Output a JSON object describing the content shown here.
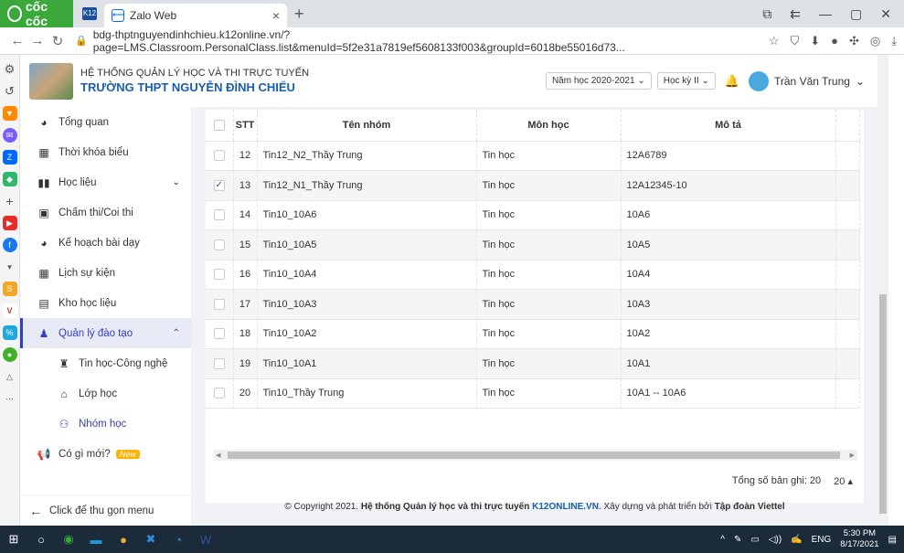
{
  "browser": {
    "brand": "cốc cốc",
    "tab_icon_text": "K12",
    "tab_label": "Zalo Web",
    "tab_close": "×",
    "new_tab": "+",
    "url": "bdg-thptnguyendinhchieu.k12online.vn/?page=LMS.Classroom.PersonalClass.list&menuId=5f2e31a7819ef5608133f003&groupId=6018be55016d73..."
  },
  "header": {
    "system_title": "HỆ THỐNG QUẢN LÝ HỌC VÀ THI TRỰC TUYẾN",
    "school_name": "TRƯỜNG THPT NGUYỄN ĐÌNH CHIỂU",
    "school_year": "Năm học 2020-2021",
    "semester": "Học kỳ II",
    "user_name": "Trần Văn Trung"
  },
  "menu": {
    "items": [
      {
        "label": "Tổng quan"
      },
      {
        "label": "Thời khóa biểu"
      },
      {
        "label": "Học liệu"
      },
      {
        "label": "Chấm thi/Coi thi"
      },
      {
        "label": "Kế hoạch bài dạy"
      },
      {
        "label": "Lịch sự kiện"
      },
      {
        "label": "Kho học liệu"
      },
      {
        "label": "Quản lý đào tạo"
      },
      {
        "label": "Tin học-Công nghệ"
      },
      {
        "label": "Lớp học"
      },
      {
        "label": "Nhóm học"
      },
      {
        "label": "Có gì mới?"
      }
    ],
    "new_badge": "New",
    "collapse_label": "Click để thu gọn menu"
  },
  "table": {
    "headers": [
      "STT",
      "Tên nhóm",
      "Môn học",
      "Mô tả"
    ],
    "rows": [
      {
        "stt": "12",
        "name": "Tin12_N2_Thầy Trung",
        "subject": "Tin học",
        "desc": "12A6789",
        "checked": false
      },
      {
        "stt": "13",
        "name": "Tin12_N1_Thầy Trung",
        "subject": "Tin học",
        "desc": "12A12345-10",
        "checked": true
      },
      {
        "stt": "14",
        "name": "Tin10_10A6",
        "subject": "Tin học",
        "desc": "10A6",
        "checked": false
      },
      {
        "stt": "15",
        "name": "Tin10_10A5",
        "subject": "Tin học",
        "desc": "10A5",
        "checked": false
      },
      {
        "stt": "16",
        "name": "Tin10_10A4",
        "subject": "Tin học",
        "desc": "10A4",
        "checked": false
      },
      {
        "stt": "17",
        "name": "Tin10_10A3",
        "subject": "Tin học",
        "desc": "10A3",
        "checked": false
      },
      {
        "stt": "18",
        "name": "Tin10_10A2",
        "subject": "Tin học",
        "desc": "10A2",
        "checked": false
      },
      {
        "stt": "19",
        "name": "Tin10_10A1",
        "subject": "Tin học",
        "desc": "10A1",
        "checked": false
      },
      {
        "stt": "20",
        "name": "Tin10_Thầy Trung",
        "subject": "Tin học",
        "desc": "10A1 -- 10A6",
        "checked": false
      }
    ],
    "total_label": "Tổng số bản ghi: 20",
    "page_size": "20 ▴"
  },
  "footer": {
    "prefix": "© Copyright 2021.",
    "system": "Hệ thống Quản lý học và thi trực tuyến",
    "site": "K12ONLINE.VN",
    "middle": ". Xây dựng và phát triển bởi",
    "company": "Tập đoàn Viettel"
  },
  "taskbar": {
    "lang": "ENG",
    "time": "5:30 PM",
    "date": "8/17/2021"
  },
  "colors": {
    "accent": "#3340c0",
    "brand_green": "#3aa83a",
    "link_blue": "#1a5fae"
  }
}
